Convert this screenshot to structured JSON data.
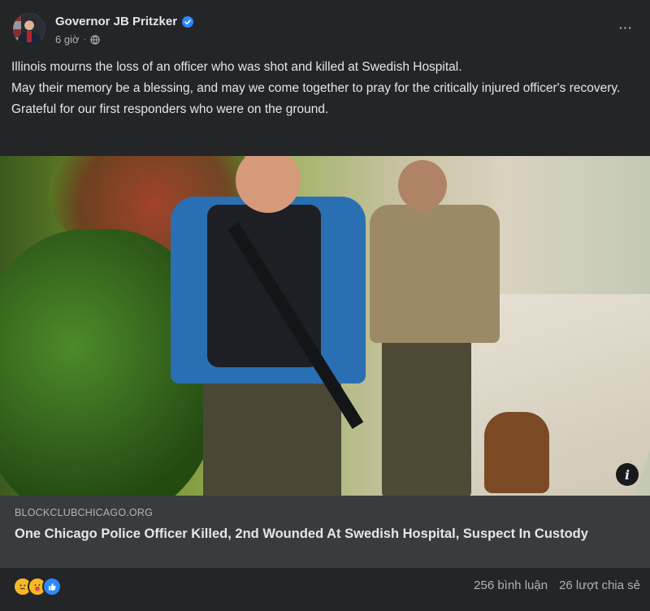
{
  "post": {
    "author": "Governor JB Pritzker",
    "time": "6 giờ",
    "separator": "·",
    "verified_icon": "verified-badge-icon",
    "privacy_icon": "globe-icon",
    "more_icon": "···",
    "paragraphs": [
      "Illinois mourns the loss of an officer who was shot and killed at Swedish Hospital.",
      "May their memory be a blessing, and may we come together to pray for the critically injured officer's recovery.",
      "Grateful for our first responders who were on the ground."
    ]
  },
  "link": {
    "domain": "BLOCKCLUBCHICAGO.ORG",
    "headline": "One Chicago Police Officer Killed, 2nd Wounded At Swedish Hospital, Suspect In Custody",
    "info_icon": "i"
  },
  "footer": {
    "reactions": [
      "sad",
      "care",
      "like"
    ],
    "comments": "256 bình luận",
    "shares": "26 lượt chia sẻ"
  },
  "colors": {
    "background": "#242526",
    "link_card": "#3a3b3c",
    "text": "#e4e6eb",
    "secondary_text": "#b0b3b8",
    "accent": "#2d88ff"
  }
}
